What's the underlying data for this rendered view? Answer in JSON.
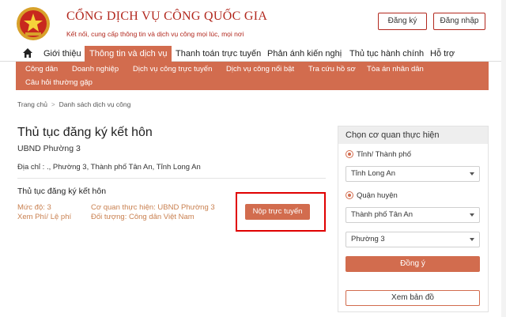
{
  "header": {
    "title": "CỔNG DỊCH VỤ CÔNG QUỐC GIA",
    "subtitle": "Kết nối, cung cấp thông tin và dịch vụ công mọi lúc, mọi nơi",
    "register_label": "Đăng ký",
    "login_label": "Đăng nhập",
    "emblem_icon": "national-emblem-icon"
  },
  "mainnav": {
    "home_icon": "home-icon",
    "items": [
      {
        "label": "Giới thiệu"
      },
      {
        "label": "Thông tin và dịch vụ",
        "active": true
      },
      {
        "label": "Thanh toán trực tuyến"
      },
      {
        "label": "Phản ánh kiến nghị"
      },
      {
        "label": "Thủ tục hành chính"
      },
      {
        "label": "Hỗ trợ"
      }
    ]
  },
  "subnav": {
    "items": [
      {
        "label": "Công dân"
      },
      {
        "label": "Doanh nghiệp"
      },
      {
        "label": "Dịch vụ công trực tuyến"
      },
      {
        "label": "Dịch vụ công nổi bật"
      },
      {
        "label": "Tra cứu hồ sơ"
      },
      {
        "label": "Tòa án nhân dân"
      },
      {
        "label": "Câu hỏi thường gặp"
      }
    ]
  },
  "breadcrumb": {
    "home": "Trang chủ",
    "current": "Danh sách dịch vụ công"
  },
  "main": {
    "title": "Thủ tục đăng ký kết hôn",
    "agency": "UBND Phường 3",
    "address": "Địa chỉ : ., Phường 3, Thành phố Tân An, Tỉnh Long An",
    "item": {
      "title": "Thủ tục đăng ký kết hôn",
      "level": "Mức độ: 3",
      "fee": "Xem Phí/ Lệ phí",
      "executing_agency": "Cơ quan thực hiện: UBND Phường 3",
      "target": "Đối tượng: Công dân Việt Nam",
      "submit_label": "Nộp trực tuyến"
    }
  },
  "panel": {
    "title": "Chọn cơ quan thực hiện",
    "radio_province": "Tỉnh/ Thành phố",
    "province_value": "Tỉnh Long An",
    "radio_district": "Quận huyện",
    "district_value": "Thành phố Tân An",
    "ward_value": "Phường 3",
    "agree_label": "Đồng ý",
    "map_label": "Xem bản đồ"
  },
  "colors": {
    "brand": "#b2281e",
    "accent": "#d26c4e",
    "meta_text": "#c98050",
    "highlight": "#e00000"
  }
}
